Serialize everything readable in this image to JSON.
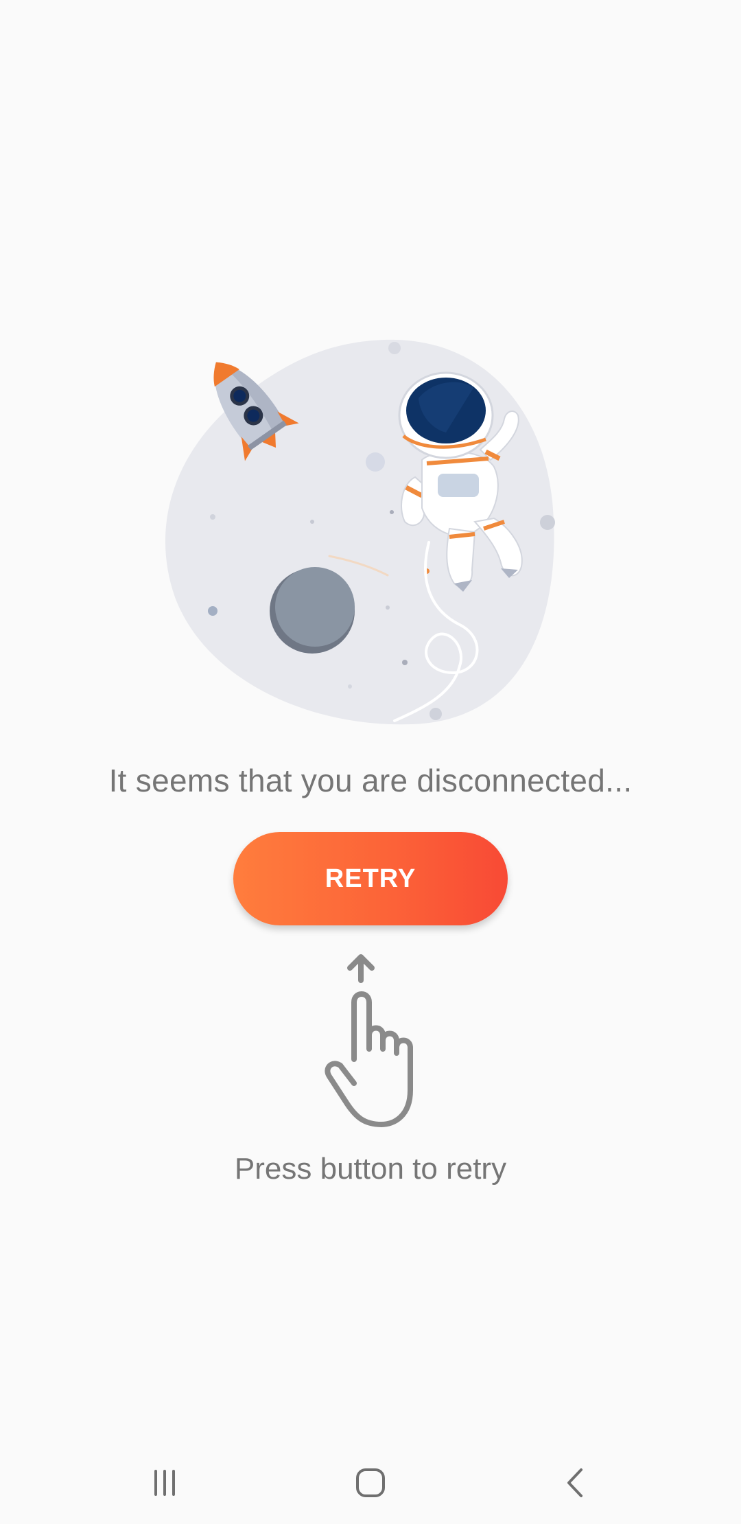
{
  "offline": {
    "message": "It seems that you are disconnected...",
    "retry_label": "RETRY",
    "hint": "Press button to retry"
  },
  "illustration": {
    "icons": [
      "rocket-icon",
      "astronaut-icon",
      "planet-icon"
    ]
  },
  "hint_icons": [
    "arrow-up-icon",
    "hand-pointer-icon"
  ],
  "nav": {
    "recents": "recents-icon",
    "home": "home-icon",
    "back": "back-icon"
  },
  "colors": {
    "background": "#fafafa",
    "button_start": "#ff7d3d",
    "button_end": "#f84a35",
    "text_gray": "#757575",
    "blob": "#e8e9ee"
  }
}
